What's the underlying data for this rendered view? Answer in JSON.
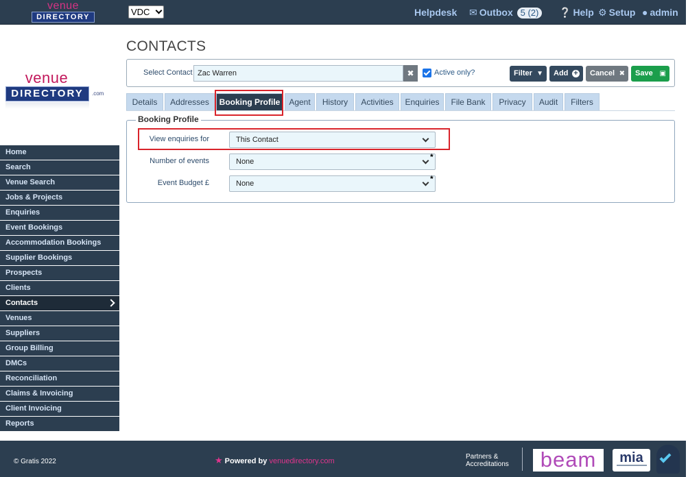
{
  "app": {
    "logo_top": "venue",
    "logo_bottom": "DIRECTORY",
    "logo_dotcom": ".com",
    "db_select": "VDC"
  },
  "topnav": {
    "helpdesk": "Helpdesk",
    "outbox": "Outbox",
    "outbox_count": "5 (2)",
    "help": "Help",
    "setup": "Setup",
    "admin": "admin"
  },
  "sidebar": {
    "items": [
      {
        "label": "Home"
      },
      {
        "label": "Search"
      },
      {
        "label": "Venue Search"
      },
      {
        "label": "Jobs & Projects"
      },
      {
        "label": "Enquiries"
      },
      {
        "label": "Event Bookings"
      },
      {
        "label": "Accommodation Bookings"
      },
      {
        "label": "Supplier Bookings"
      },
      {
        "label": "Prospects"
      },
      {
        "label": "Clients"
      },
      {
        "label": "Contacts",
        "active": true
      },
      {
        "label": "Venues"
      },
      {
        "label": "Suppliers"
      },
      {
        "label": "Group Billing"
      },
      {
        "label": "DMCs"
      },
      {
        "label": "Reconciliation"
      },
      {
        "label": "Claims & Invoicing"
      },
      {
        "label": "Client Invoicing"
      },
      {
        "label": "Reports"
      }
    ]
  },
  "page": {
    "title": "CONTACTS"
  },
  "contact_bar": {
    "select_label": "Select Contact",
    "contact_value": "Zac Warren",
    "active_only_label": "Active only?",
    "active_only_checked": true,
    "filter_label": "Filter",
    "add_label": "Add",
    "cancel_label": "Cancel",
    "save_label": "Save"
  },
  "tabs": [
    {
      "label": "Details"
    },
    {
      "label": "Addresses"
    },
    {
      "label": "Booking Profile",
      "active": true
    },
    {
      "label": "Agent"
    },
    {
      "label": "History"
    },
    {
      "label": "Activities"
    },
    {
      "label": "Enquiries"
    },
    {
      "label": "File Bank"
    },
    {
      "label": "Privacy"
    },
    {
      "label": "Audit"
    },
    {
      "label": "Filters"
    }
  ],
  "booking_profile": {
    "legend": "Booking Profile",
    "fields": [
      {
        "label": "View enquiries for",
        "value": "This Contact",
        "required": false
      },
      {
        "label": "Number of events",
        "value": "None",
        "required": true
      },
      {
        "label": "Event Budget £",
        "value": "None",
        "required": true
      }
    ],
    "required_mark": "*"
  },
  "footer": {
    "copyright": "© Gratis 2022",
    "powered_by": "Powered by",
    "powered_site": "venuedirectory.com",
    "partners_line1": "Partners &",
    "partners_line2": "Accreditations",
    "beam_logo": "beam",
    "mia_logo": "mia"
  },
  "colors": {
    "header_bg": "#2c3e50",
    "accent_pink": "#e0348c",
    "highlight_red": "#d9232a",
    "save_green": "#1b9e4b"
  }
}
